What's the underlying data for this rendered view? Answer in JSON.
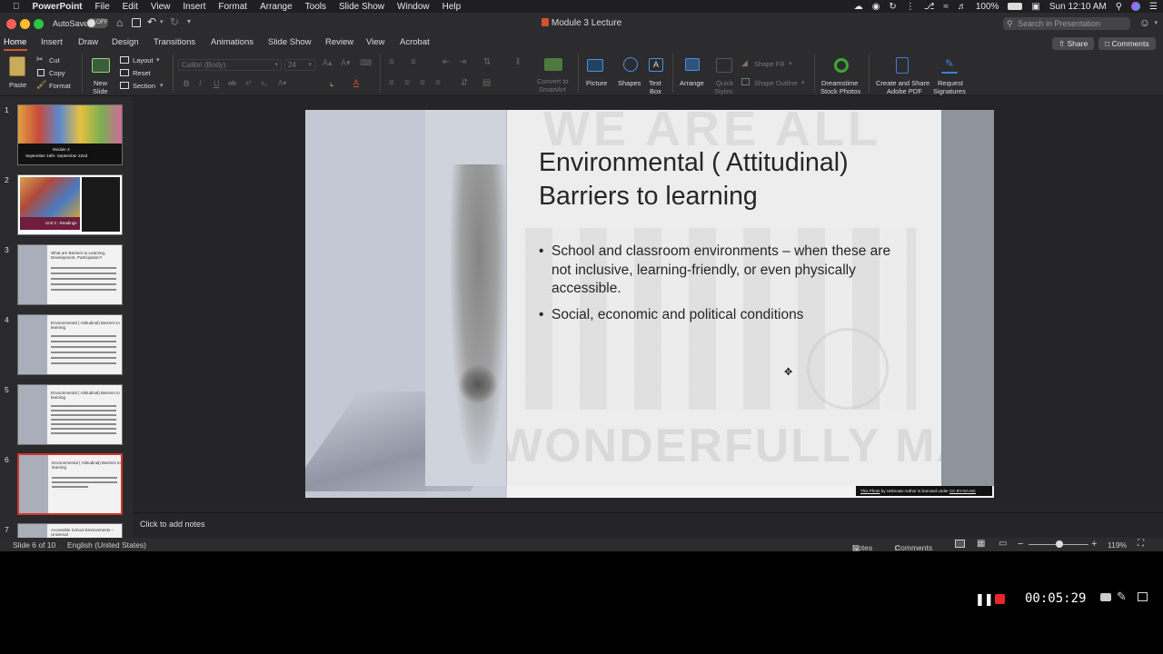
{
  "menubar": {
    "app_name": "PowerPoint",
    "items": [
      "File",
      "Edit",
      "View",
      "Insert",
      "Format",
      "Arrange",
      "Tools",
      "Slide Show",
      "Window",
      "Help"
    ],
    "battery": "100%",
    "clock": "Sun 12:10 AM"
  },
  "titlebar": {
    "autosave_label": "AutoSave",
    "autosave_state": "OFF",
    "document_title": "Module 3 Lecture",
    "search_placeholder": "Search in Presentation"
  },
  "ribbon_tabs": {
    "tabs": [
      "Home",
      "Insert",
      "Draw",
      "Design",
      "Transitions",
      "Animations",
      "Slide Show",
      "Review",
      "View",
      "Acrobat"
    ],
    "active": "Home",
    "share_label": "Share",
    "comments_label": "Comments"
  },
  "ribbon": {
    "paste": "Paste",
    "cut": "Cut",
    "copy": "Copy",
    "format": "Format",
    "new_slide_1": "New",
    "new_slide_2": "Slide",
    "layout": "Layout",
    "reset": "Reset",
    "section": "Section",
    "font_name": "Calibri (Body)",
    "font_size": "24",
    "convert_1": "Convert to",
    "convert_2": "SmartArt",
    "picture": "Picture",
    "shapes": "Shapes",
    "text_box_1": "Text",
    "text_box_2": "Box",
    "arrange": "Arrange",
    "quick_styles_1": "Quick",
    "quick_styles_2": "Styles",
    "shape_fill": "Shape Fill",
    "shape_outline": "Shape Outline",
    "dreamstime_1": "Dreamstime",
    "dreamstime_2": "Stock Photos",
    "adobe_1": "Create and Share",
    "adobe_2": "Adobe PDF",
    "signatures_1": "Request",
    "signatures_2": "Signatures",
    "colors": {
      "accent": "#d35230",
      "dreamstime": "#3aa935",
      "adobe": "#3d7fd6"
    }
  },
  "thumbnails": [
    {
      "num": "1",
      "title": "Module 3",
      "sub": "September 16th- September 22nd"
    },
    {
      "num": "2",
      "title": "",
      "sub": "Unit 3 : Readings"
    },
    {
      "num": "3",
      "title": "What are Barriers to Learning, Development, Participation?",
      "sub": ""
    },
    {
      "num": "4",
      "title": "Environmental ( Attitudinal) Barriers to learning",
      "sub": ""
    },
    {
      "num": "5",
      "title": "Environmental ( Attitudinal) Barriers to learning",
      "sub": ""
    },
    {
      "num": "6",
      "title": "Environmental ( Attitudinal) Barriers to learning",
      "sub": ""
    },
    {
      "num": "7",
      "title": "Accessible School Environments – Universal",
      "sub": ""
    }
  ],
  "slide": {
    "title": "Environmental ( Attitudinal) Barriers to learning",
    "bullets": [
      "School and classroom environments – when these are not inclusive, learning-friendly, or even physically accessible.",
      "Social, economic and political conditions"
    ],
    "watermark_top": "WE ARE ALL",
    "watermark_bottom": "WONDERFULLY MADE",
    "credit_link": "This Photo",
    "credit_text": " by Unknown Author is licensed under ",
    "credit_license": "CC BY-SA-NC"
  },
  "notes": {
    "placeholder": "Click to add notes"
  },
  "statusbar": {
    "slide_position": "Slide 6 of 10",
    "language": "English (United States)",
    "notes_label": "Notes",
    "comments_label": "Comments",
    "zoom": "119%"
  },
  "recorder": {
    "elapsed": "00:05:29"
  }
}
